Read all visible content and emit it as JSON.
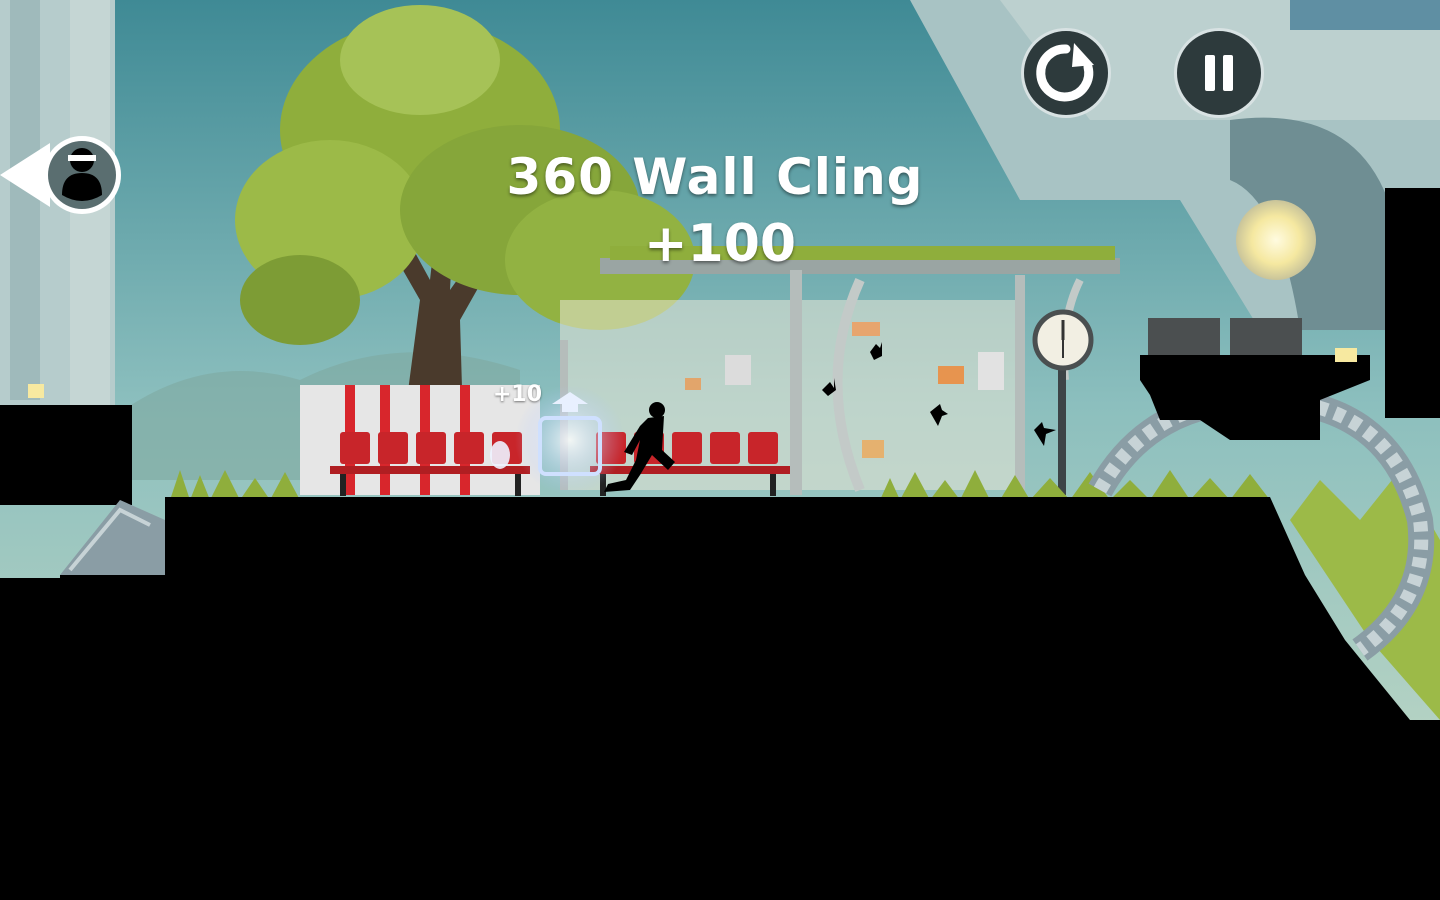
{
  "hud": {
    "trick_name": "360 Wall Cling",
    "trick_points": "+100",
    "bonus_points": "+10"
  },
  "controls": {
    "restart_icon": "restart-icon",
    "pause_icon": "pause-icon",
    "pursuer_icon": "hunter-silhouette-icon"
  },
  "colors": {
    "hud_button_fill": "#2d3a3c",
    "hud_button_ring": "#d8e2e3",
    "sky": "#7fb3b8",
    "silhouette": "#000000",
    "bench_red": "#c8252a",
    "foliage": "#8fae3c",
    "powerup_glow": "#a9c4ff"
  },
  "scene": {
    "clock_icon": "clock-icon",
    "bird_icon": "bird-icon",
    "player_icon": "runner-silhouette"
  }
}
